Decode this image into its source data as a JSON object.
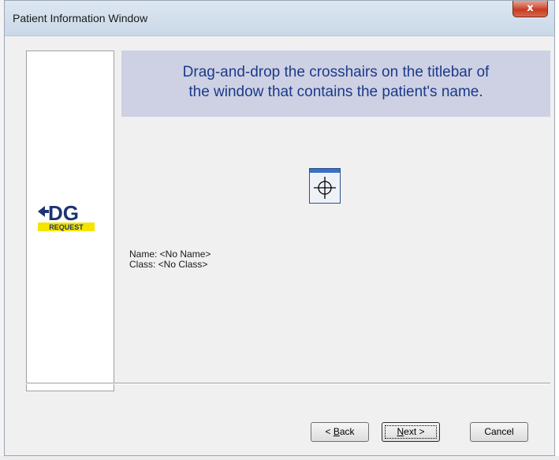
{
  "window": {
    "title": "Patient Information Window",
    "close_label": "x"
  },
  "header": {
    "line1": "Drag-and-drop the crosshairs on the titlebar of",
    "line2": "the window that contains the patient's name."
  },
  "logo": {
    "mark": "DG",
    "tagline": "REQUEST",
    "colors": {
      "mark": "#1e3470",
      "tag_bg": "#f5e400",
      "tag_text": "#1e3470"
    }
  },
  "crosshair": {
    "icon": "crosshair-icon"
  },
  "info": {
    "name_line": "Name: <No Name>",
    "class_line": "Class: <No Class>"
  },
  "buttons": {
    "back": {
      "prefix": "< ",
      "accel": "B",
      "rest": "ack"
    },
    "next": {
      "accel": "N",
      "rest": "ext >"
    },
    "cancel": "Cancel"
  },
  "colors": {
    "banner_bg": "#cdd1e3",
    "banner_text": "#1c3a8a",
    "close_button": "#c43c22"
  }
}
